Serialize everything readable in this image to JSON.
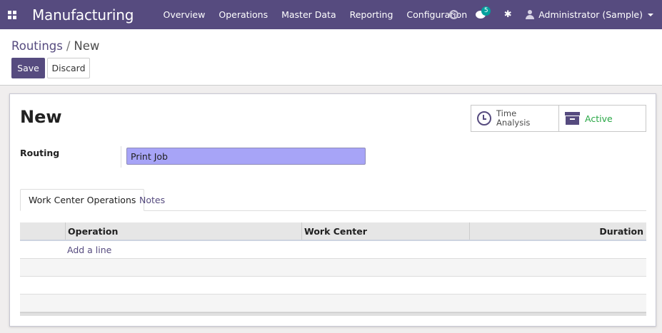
{
  "navbar": {
    "app_title": "Manufacturing",
    "menu": [
      "Overview",
      "Operations",
      "Master Data",
      "Reporting",
      "Configuration"
    ],
    "message_count": "5",
    "user_name": "Administrator (Sample)"
  },
  "control": {
    "breadcrumb_parent": "Routings",
    "breadcrumb_separator": "/",
    "breadcrumb_current": "New",
    "save_label": "Save",
    "discard_label": "Discard"
  },
  "form": {
    "title": "New",
    "time_analysis_label": "Time\nAnalysis",
    "active_label": "Active",
    "routing_label": "Routing",
    "routing_value": "Print Job",
    "tabs": [
      "Work Center Operations",
      "Notes"
    ],
    "columns": [
      "Operation",
      "Work Center",
      "Duration"
    ],
    "add_line_label": "Add a line"
  },
  "colors": {
    "brand": "#564b7f",
    "active": "#28a745",
    "required_field": "#a7a4f7"
  }
}
